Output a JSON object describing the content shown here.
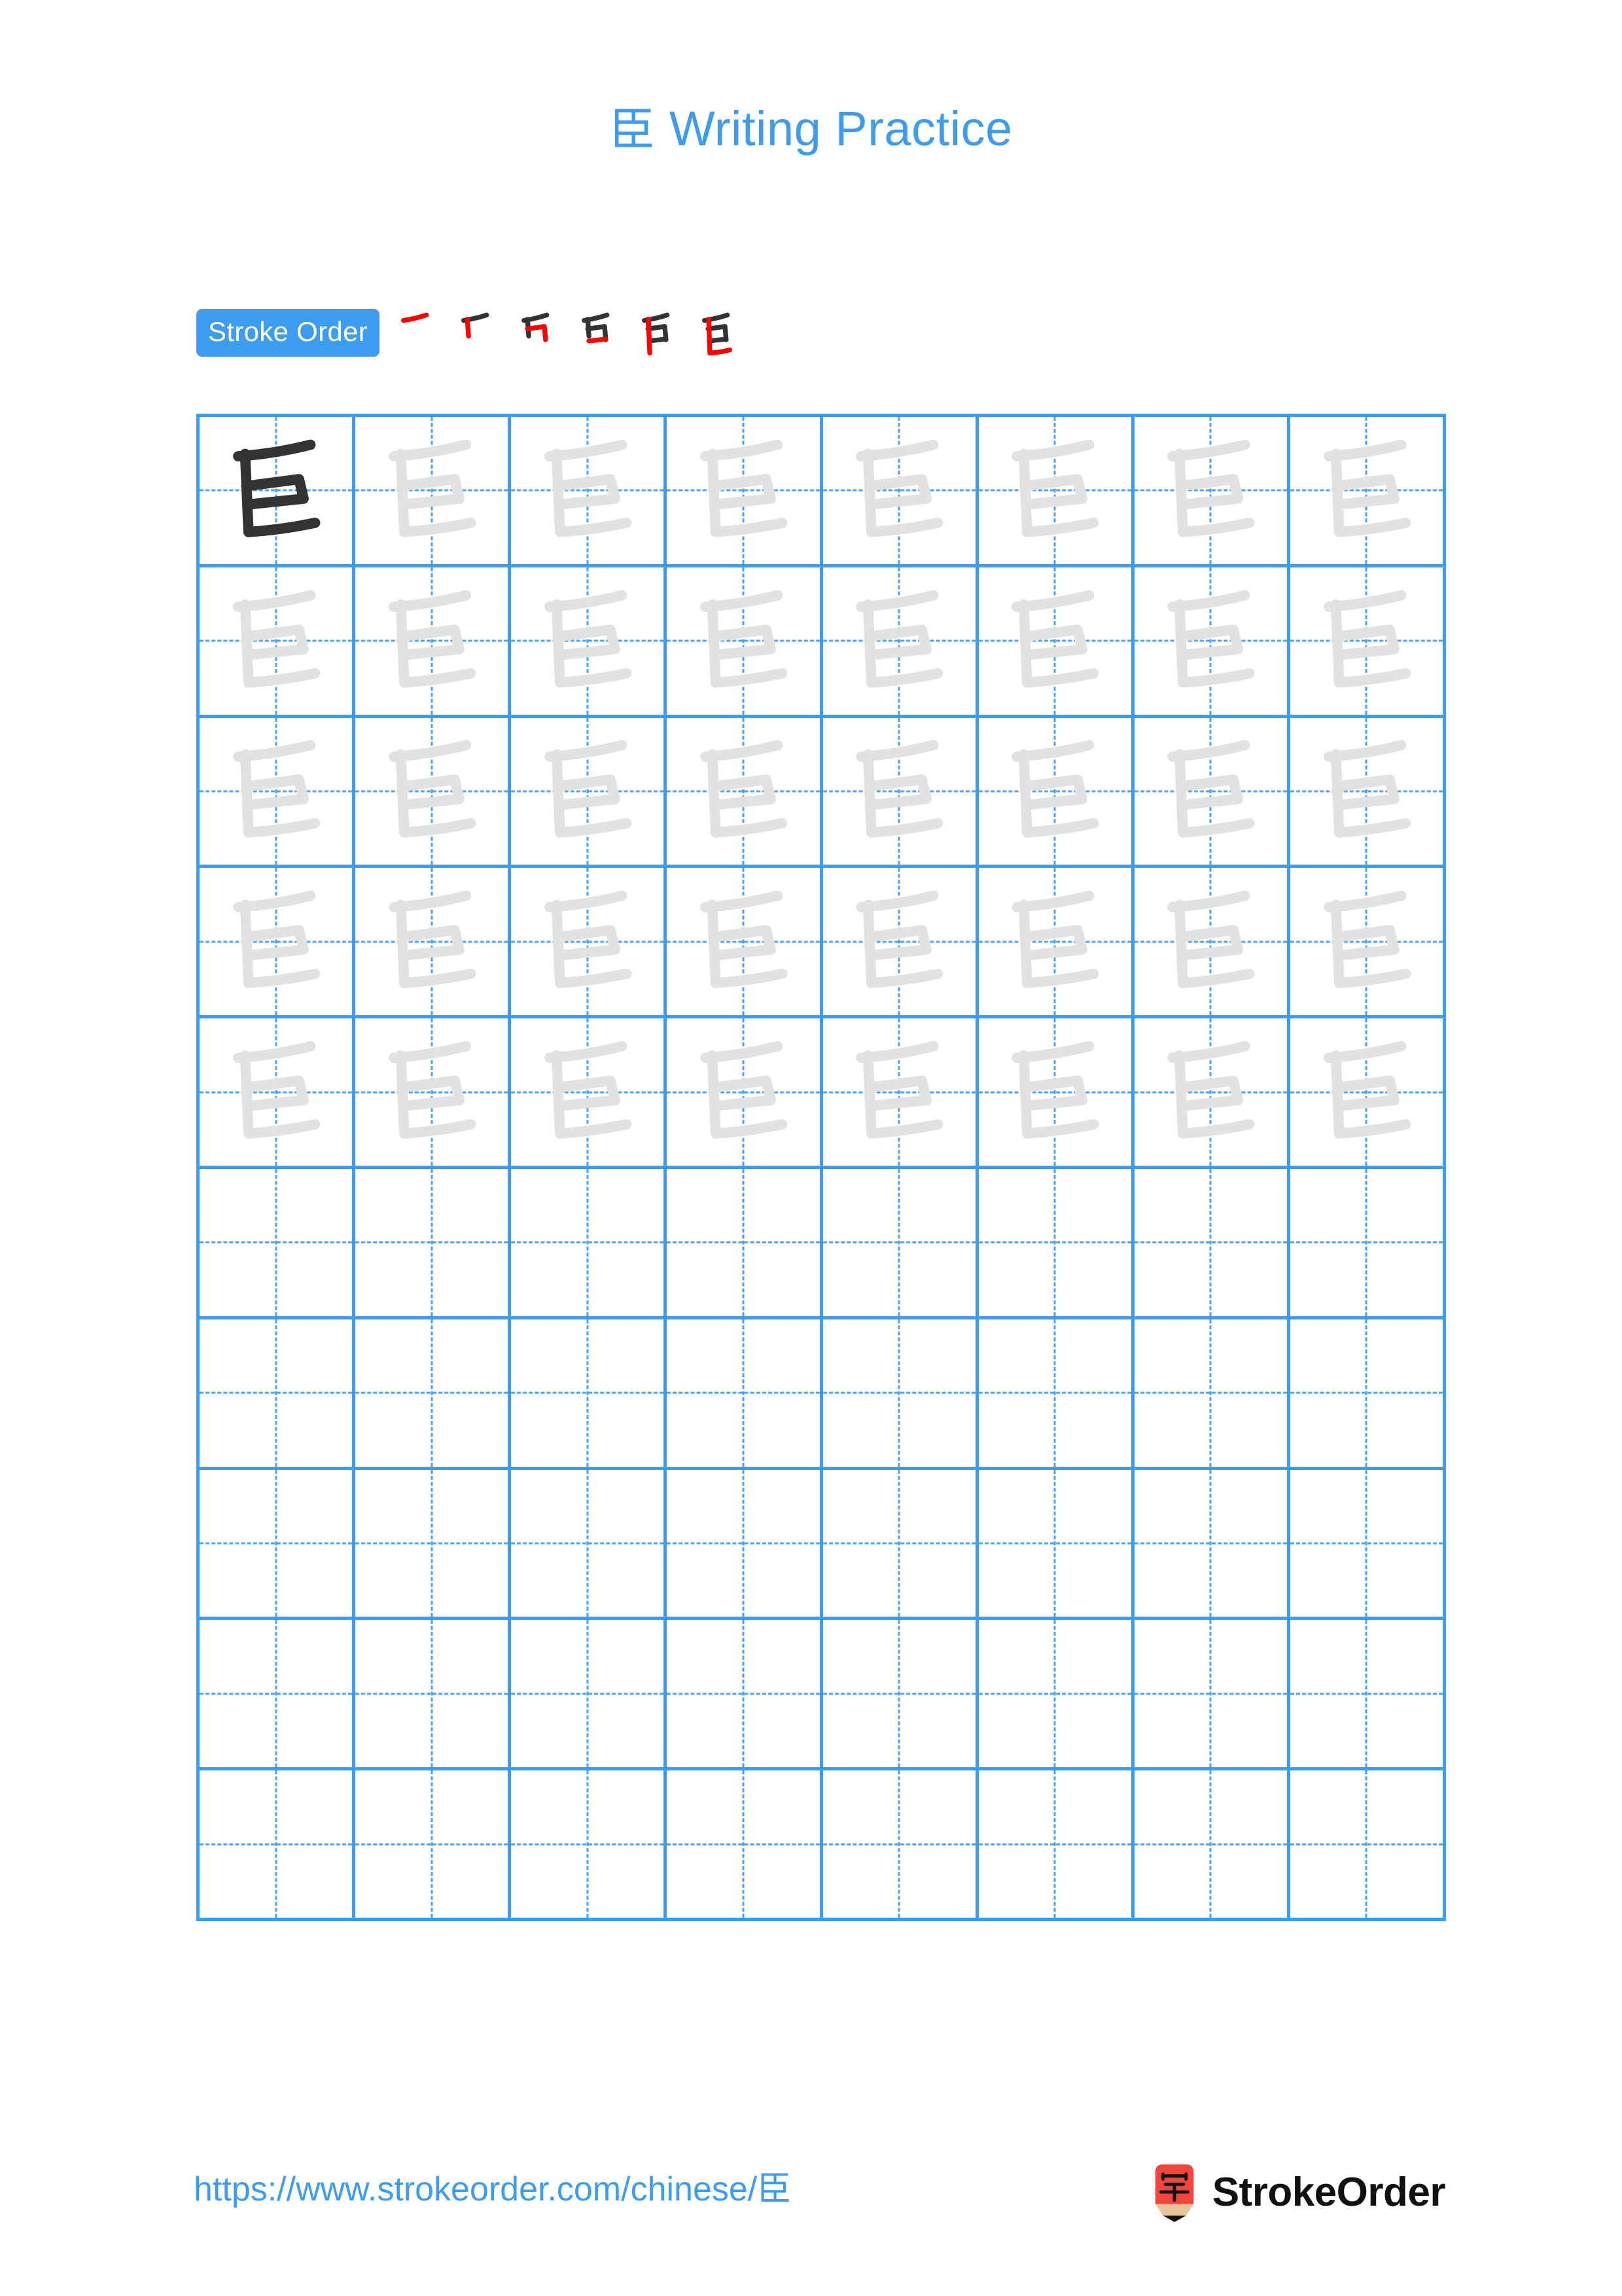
{
  "character": "臣",
  "title": {
    "character": "臣",
    "text": " Writing Practice",
    "full": "臣 Writing Practice",
    "color": "#3d9bf0"
  },
  "stroke_order": {
    "badge_label": "Stroke Order",
    "badge_bg": "#3d9bf0",
    "badge_text_color": "#ffffff",
    "stroke_count": 6,
    "new_stroke_color": "#ff0000",
    "old_stroke_color": "#333333",
    "steps": [
      {
        "index": 1,
        "new_stroke": "horizontal",
        "strokes_shown": 1
      },
      {
        "index": 2,
        "new_stroke": "vertical",
        "strokes_shown": 2
      },
      {
        "index": 3,
        "new_stroke": "horizontal-fold-vertical",
        "strokes_shown": 3
      },
      {
        "index": 4,
        "new_stroke": "horizontal",
        "strokes_shown": 4
      },
      {
        "index": 5,
        "new_stroke": "vertical",
        "strokes_shown": 5
      },
      {
        "index": 6,
        "new_stroke": "horizontal",
        "strokes_shown": 6
      }
    ]
  },
  "grid": {
    "columns": 8,
    "rows": 10,
    "line_color": "#3d9bf0",
    "guide_color": "#4aa3f2",
    "model_glyph_color": "#333333",
    "trace_glyph_color": "#e2e2e2",
    "rows_data": [
      {
        "row": 1,
        "cells": [
          "model",
          "trace",
          "trace",
          "trace",
          "trace",
          "trace",
          "trace",
          "trace"
        ]
      },
      {
        "row": 2,
        "cells": [
          "trace",
          "trace",
          "trace",
          "trace",
          "trace",
          "trace",
          "trace",
          "trace"
        ]
      },
      {
        "row": 3,
        "cells": [
          "trace",
          "trace",
          "trace",
          "trace",
          "trace",
          "trace",
          "trace",
          "trace"
        ]
      },
      {
        "row": 4,
        "cells": [
          "trace",
          "trace",
          "trace",
          "trace",
          "trace",
          "trace",
          "trace",
          "trace"
        ]
      },
      {
        "row": 5,
        "cells": [
          "trace",
          "trace",
          "trace",
          "trace",
          "trace",
          "trace",
          "trace",
          "trace"
        ]
      },
      {
        "row": 6,
        "cells": [
          "empty",
          "empty",
          "empty",
          "empty",
          "empty",
          "empty",
          "empty",
          "empty"
        ]
      },
      {
        "row": 7,
        "cells": [
          "empty",
          "empty",
          "empty",
          "empty",
          "empty",
          "empty",
          "empty",
          "empty"
        ]
      },
      {
        "row": 8,
        "cells": [
          "empty",
          "empty",
          "empty",
          "empty",
          "empty",
          "empty",
          "empty",
          "empty"
        ]
      },
      {
        "row": 9,
        "cells": [
          "empty",
          "empty",
          "empty",
          "empty",
          "empty",
          "empty",
          "empty",
          "empty"
        ]
      },
      {
        "row": 10,
        "cells": [
          "empty",
          "empty",
          "empty",
          "empty",
          "empty",
          "empty",
          "empty",
          "empty"
        ]
      }
    ]
  },
  "footer": {
    "url": "https://www.strokeorder.com/chinese/臣",
    "url_color": "#3d9bf0",
    "brand_name": "StrokeOrder",
    "logo_character": "字",
    "logo_bg": "#f4443c",
    "logo_pencil_wood": "#e8c39e"
  }
}
